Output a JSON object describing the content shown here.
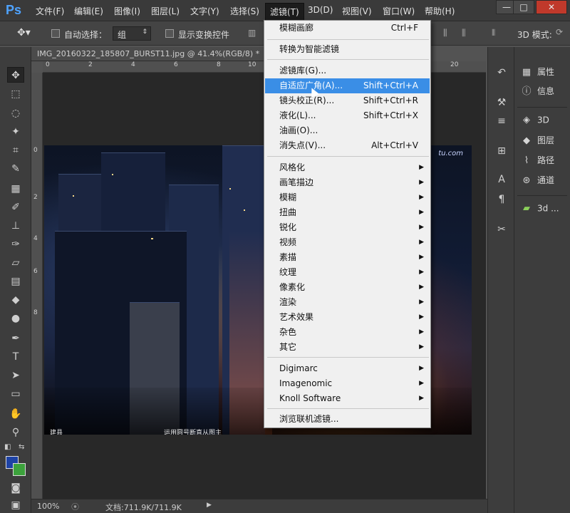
{
  "app": {
    "logo": "Ps"
  },
  "menubar": {
    "items": [
      "文件(F)",
      "编辑(E)",
      "图像(I)",
      "图层(L)",
      "文字(Y)",
      "选择(S)",
      "滤镜(T)",
      "3D(D)",
      "视图(V)",
      "窗口(W)",
      "帮助(H)"
    ],
    "active_index": 6
  },
  "window_controls": {
    "minimize": "—",
    "restore": "□",
    "close": "✕"
  },
  "options_bar": {
    "auto_select_label": "自动选择：",
    "auto_select_value": "组",
    "show_transform_label": "显示变换控件",
    "mode_3d_label": "3D 模式:"
  },
  "document": {
    "tab_title": "IMG_20160322_185807_BURST11.jpg @ 41.4%(RGB/8) *",
    "zoom": "100%",
    "doc_size": "文档:711.9K/711.9K",
    "ruler_h_labels": [
      "0",
      "2",
      "4",
      "6",
      "8",
      "10",
      "20"
    ],
    "ruler_v_labels": [
      "0",
      "2",
      "4",
      "6",
      "8"
    ],
    "watermark": "tu.com",
    "photo_caption_left": "建县",
    "photo_caption_mid": "运用圆号断直从图主"
  },
  "filter_menu": {
    "groups": [
      [
        {
          "label": "模糊画廊",
          "shortcut": "Ctrl+F"
        }
      ],
      [
        {
          "label": "转换为智能滤镜",
          "shortcut": ""
        }
      ],
      [
        {
          "label": "滤镜库(G)...",
          "shortcut": ""
        },
        {
          "label": "自适应广角(A)...",
          "shortcut": "Shift+Ctrl+A",
          "highlighted": true
        },
        {
          "label": "镜头校正(R)...",
          "shortcut": "Shift+Ctrl+R"
        },
        {
          "label": "液化(L)...",
          "shortcut": "Shift+Ctrl+X"
        },
        {
          "label": "油画(O)...",
          "shortcut": ""
        },
        {
          "label": "消失点(V)...",
          "shortcut": "Alt+Ctrl+V"
        }
      ],
      [
        {
          "label": "风格化",
          "submenu": true
        },
        {
          "label": "画笔描边",
          "submenu": true
        },
        {
          "label": "模糊",
          "submenu": true
        },
        {
          "label": "扭曲",
          "submenu": true
        },
        {
          "label": "锐化",
          "submenu": true
        },
        {
          "label": "视频",
          "submenu": true
        },
        {
          "label": "素描",
          "submenu": true
        },
        {
          "label": "纹理",
          "submenu": true
        },
        {
          "label": "像素化",
          "submenu": true
        },
        {
          "label": "渲染",
          "submenu": true
        },
        {
          "label": "艺术效果",
          "submenu": true
        },
        {
          "label": "杂色",
          "submenu": true
        },
        {
          "label": "其它",
          "submenu": true
        }
      ],
      [
        {
          "label": "Digimarc",
          "submenu": true
        },
        {
          "label": "Imagenomic",
          "submenu": true
        },
        {
          "label": "Knoll Software",
          "submenu": true
        }
      ],
      [
        {
          "label": "浏览联机滤镜...",
          "shortcut": ""
        }
      ]
    ]
  },
  "right_panels": {
    "items": [
      {
        "label": "属性",
        "icon": "properties-icon"
      },
      {
        "label": "信息",
        "icon": "info-icon"
      },
      {
        "label": "3D",
        "icon": "3d-icon"
      },
      {
        "label": "图层",
        "icon": "layers-icon"
      },
      {
        "label": "路径",
        "icon": "paths-icon"
      },
      {
        "label": "通道",
        "icon": "channels-icon"
      },
      {
        "label": "3d ...",
        "icon": "3d-material-icon"
      }
    ]
  },
  "colors": {
    "foreground": "#1e43a5",
    "background": "#3ca23c",
    "menu_highlight": "#3a8ee6"
  }
}
